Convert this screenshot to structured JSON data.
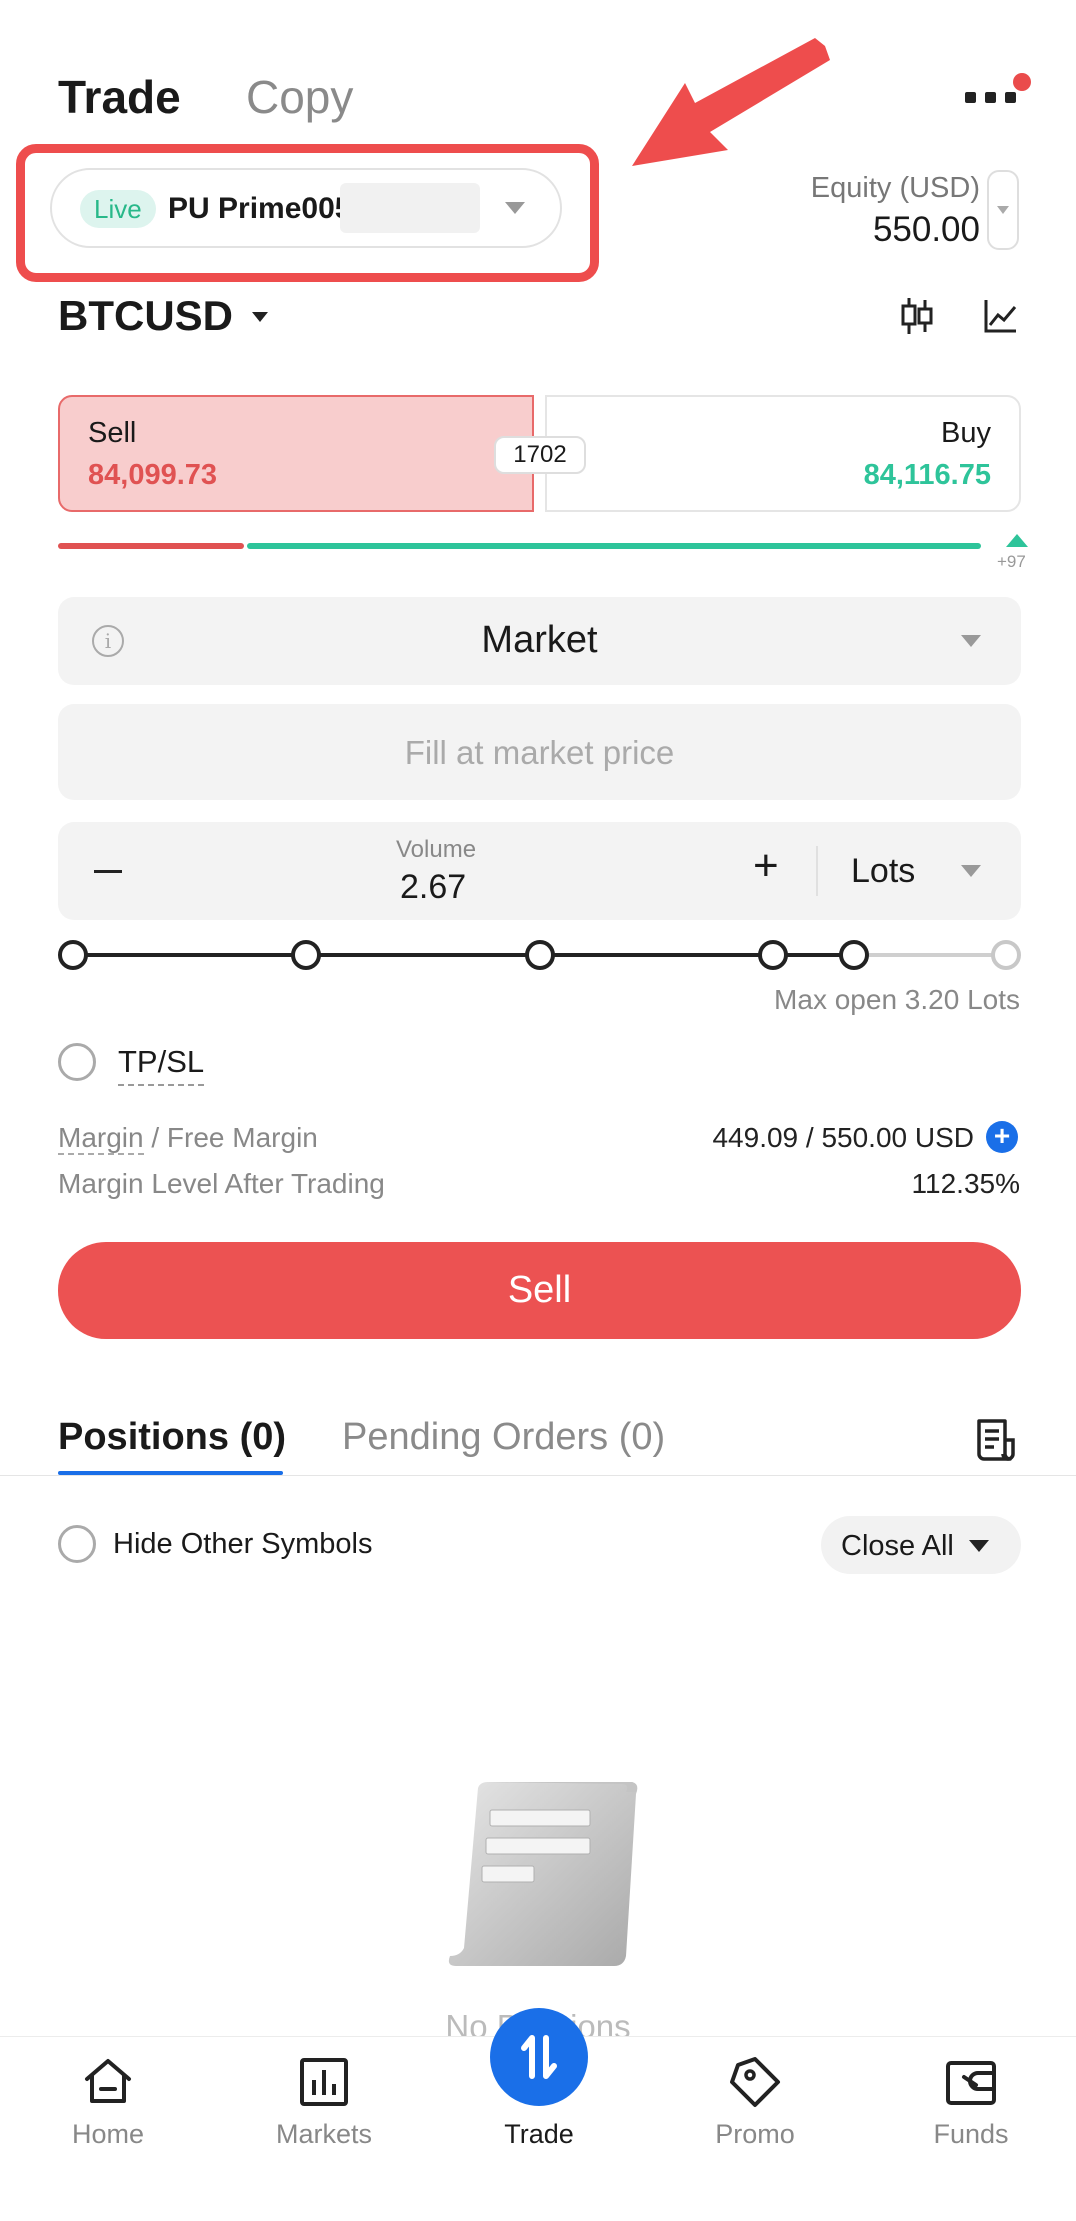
{
  "header": {
    "tab_trade": "Trade",
    "tab_copy": "Copy",
    "more_icon": "more-icon"
  },
  "account": {
    "badge": "Live",
    "name": "PU Prime005"
  },
  "equity": {
    "label": "Equity (USD)",
    "value": "550.00"
  },
  "symbol": {
    "name": "BTCUSD"
  },
  "quote": {
    "sell_label": "Sell",
    "sell_price": "84,099.73",
    "buy_label": "Buy",
    "buy_price": "84,116.75",
    "spread": "1702",
    "sentiment_delta": "+97"
  },
  "order": {
    "type": "Market",
    "price_placeholder": "Fill at market price",
    "volume_label": "Volume",
    "volume_value": "2.67",
    "unit": "Lots",
    "max_open": "Max open 3.20 Lots",
    "tpsl_label": "TP/SL",
    "margin_label_a": "Margin",
    "margin_label_b": " / Free Margin",
    "margin_value": "449.09 / 550.00 USD",
    "margin_level_label": "Margin Level After Trading",
    "margin_level_value": "112.35%",
    "submit_label": "Sell"
  },
  "positions": {
    "tab_positions": "Positions (0)",
    "tab_pending": "Pending Orders (0)",
    "hide_other_label": "Hide Other Symbols",
    "close_all_label": "Close All",
    "empty_text": "No Positions"
  },
  "nav": {
    "items": [
      {
        "label": "Home",
        "icon": "home-icon"
      },
      {
        "label": "Markets",
        "icon": "markets-icon"
      },
      {
        "label": "Trade",
        "icon": "trade-icon"
      },
      {
        "label": "Promo",
        "icon": "promo-icon"
      },
      {
        "label": "Funds",
        "icon": "funds-icon"
      }
    ]
  },
  "colors": {
    "sell": "#ec5252",
    "buy": "#2ec49a",
    "accent": "#1a6fe8",
    "highlight_box": "#ee4d4d"
  }
}
